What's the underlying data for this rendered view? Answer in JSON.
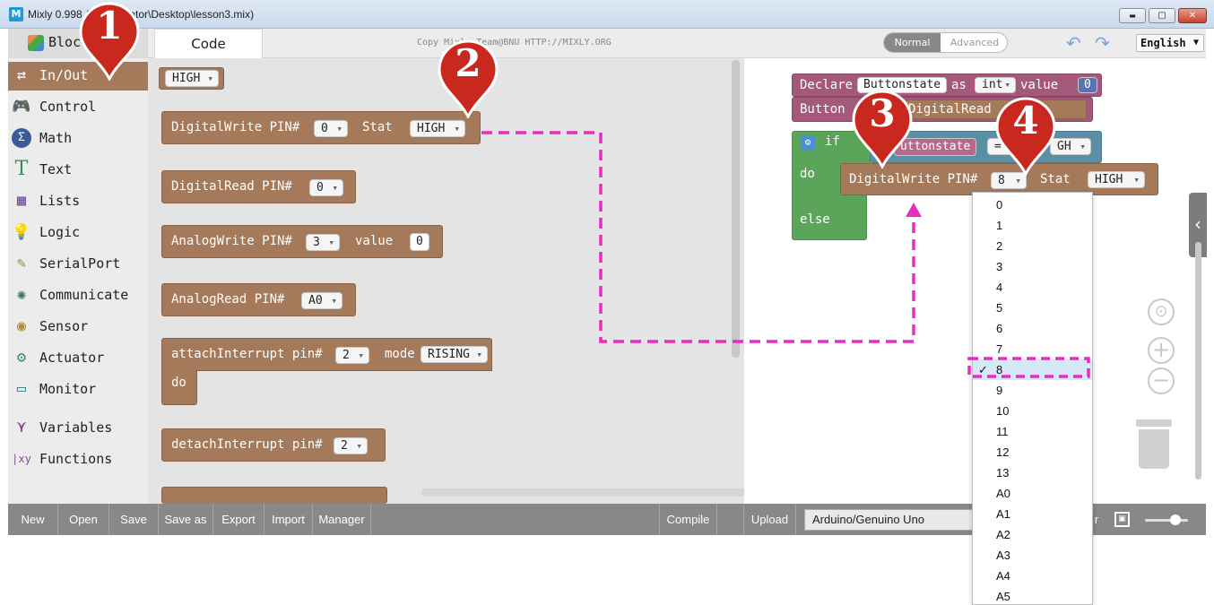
{
  "window": {
    "title": "Mixly 0.998 Administrator\\Desktop\\lesson3.mix)"
  },
  "tabs": {
    "blocks": "Bloc",
    "code": "Code"
  },
  "copyright": "Copy Mixly Team@BNU HTTP://MIXLY.ORG",
  "mode": {
    "normal": "Normal",
    "advanced": "Advanced"
  },
  "language": "English",
  "categories": [
    {
      "label": "In/Out",
      "icon": "swap-arrows-icon",
      "selected": true
    },
    {
      "label": "Control",
      "icon": "gamepad-icon"
    },
    {
      "label": "Math",
      "icon": "math-icon"
    },
    {
      "label": "Text",
      "icon": "text-icon"
    },
    {
      "label": "Lists",
      "icon": "lists-icon"
    },
    {
      "label": "Logic",
      "icon": "bulb-icon"
    },
    {
      "label": "SerialPort",
      "icon": "plug-icon"
    },
    {
      "label": "Communicate",
      "icon": "satellite-icon"
    },
    {
      "label": "Sensor",
      "icon": "sensor-icon"
    },
    {
      "label": "Actuator",
      "icon": "actuator-icon"
    },
    {
      "label": "Monitor",
      "icon": "monitor-icon"
    },
    {
      "label": "Variables",
      "icon": "variables-icon"
    },
    {
      "label": "Functions",
      "icon": "functions-icon"
    }
  ],
  "flyout": {
    "high_block": "HIGH",
    "digitalwrite": {
      "label": "DigitalWrite PIN#",
      "pin": "0",
      "stat_label": "Stat",
      "stat": "HIGH"
    },
    "digitalread": {
      "label": "DigitalRead PIN#",
      "pin": "0"
    },
    "analogwrite": {
      "label": "AnalogWrite PIN#",
      "pin": "3",
      "value_label": "value",
      "value": "0"
    },
    "analogread": {
      "label": "AnalogRead PIN#",
      "pin": "A0"
    },
    "attachinterrupt": {
      "label": "attachInterrupt pin#",
      "pin": "2",
      "mode_label": "mode",
      "mode": "RISING",
      "do_label": "do"
    },
    "detachinterrupt": {
      "label": "detachInterrupt pin#",
      "pin": "2"
    }
  },
  "workspace": {
    "declare": {
      "label": "Declare",
      "var": "Buttonstate",
      "as": "as",
      "type": "int",
      "value_label": "value",
      "value": "0"
    },
    "assign": {
      "label": "Button",
      "read_label": "DigitalRead"
    },
    "if_block": {
      "if": "if",
      "do": "do",
      "else": "else",
      "var": "uttonstate",
      "op": "=",
      "cmp": "GH"
    },
    "digitalwrite": {
      "label": "DigitalWrite PIN#",
      "pin": "8",
      "stat_label": "Stat",
      "stat": "HIGH"
    }
  },
  "pin_menu": {
    "options": [
      "0",
      "1",
      "2",
      "3",
      "4",
      "5",
      "6",
      "7",
      "8",
      "9",
      "10",
      "11",
      "12",
      "13",
      "A0",
      "A1",
      "A2",
      "A3",
      "A4",
      "A5"
    ],
    "selected": "8",
    "check": "✓"
  },
  "toolbar": {
    "new": "New",
    "open": "Open",
    "save": "Save",
    "save_as": "Save as",
    "export": "Export",
    "import": "Import",
    "manager": "Manager",
    "compile": "Compile",
    "upload": "Upload",
    "board": "Arduino/Genuino Uno",
    "partial": "r"
  },
  "annotations": [
    "1",
    "2",
    "3",
    "4"
  ],
  "colors": {
    "io_block": "#a47a5b",
    "variable_block": "#a5597a",
    "logic_block": "#5b8fa5",
    "control_block": "#5ba55b",
    "marker_red": "#c8281e",
    "dash_magenta": "#e62fbd"
  }
}
